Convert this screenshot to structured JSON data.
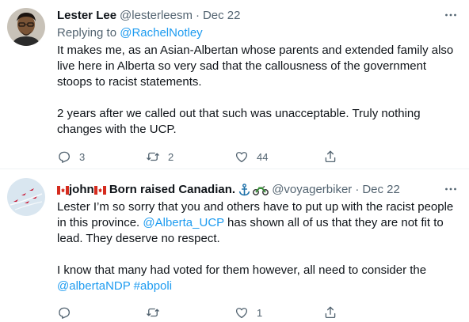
{
  "tweets": [
    {
      "name": "Lester Lee",
      "handle": "@lesterleesm",
      "dot": "·",
      "date": "Dec 22",
      "replying_prefix": "Replying to ",
      "replying_to": "@RachelNotley",
      "body_lines": [
        "It makes me, as an Asian-Albertan whose parents and extended family also",
        "live here in Alberta so very sad that the callousness of the government",
        "stoops to racist statements.",
        "",
        "2 years after we called out that such was unacceptable. Truly nothing",
        "changes with the UCP."
      ],
      "stats": {
        "replies": "3",
        "retweets": "2",
        "likes": "44"
      },
      "more_icon": "more-horizontal-icon"
    },
    {
      "name_part1": "john",
      "name_part2": " Born raised Canadian. ",
      "handle": "@voyagerbiker",
      "dot": "·",
      "date": "Dec 22",
      "body": {
        "line1": "Lester I’m so sorry that you and others have to put up with the racist people",
        "line2": "in this province. ",
        "mention": "@Alberta_UCP",
        "line2_rest": " has shown all of us that they are not fit to",
        "line3": "lead. They deserve no respect.",
        "line4": "I know that many had voted for them however, all need to consider the",
        "mention2": "@albertaNDP",
        "space": " ",
        "hashtag": "#abpoli"
      },
      "stats": {
        "replies": "",
        "retweets": "",
        "likes": "1"
      },
      "emojis": [
        "canada-flag",
        "canada-flag",
        "anchor",
        "motorcycle"
      ]
    }
  ],
  "colors": {
    "accent": "#1d9bf0",
    "secondary_text": "#536471",
    "primary_text": "#0f1419"
  }
}
